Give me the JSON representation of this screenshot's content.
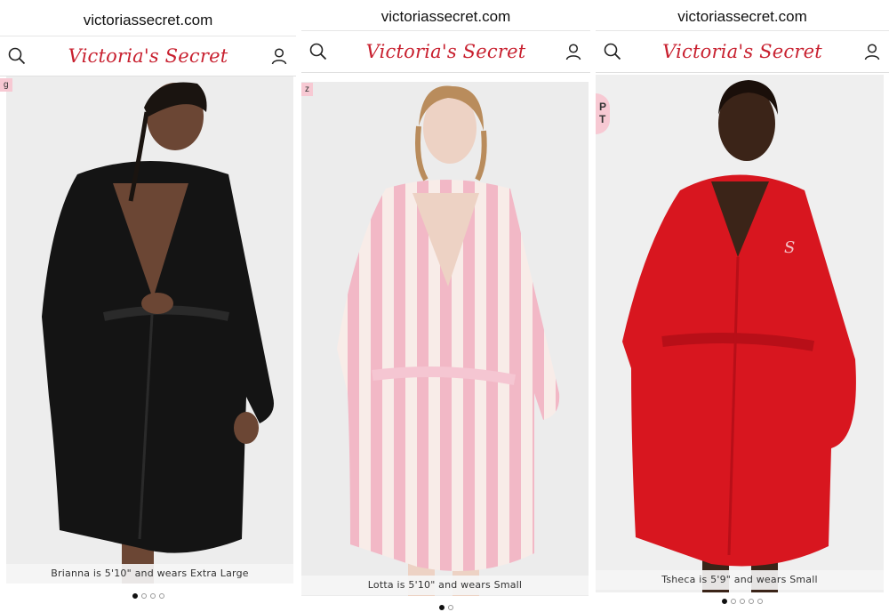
{
  "panels": [
    {
      "url": "victoriassecret.com",
      "logo": "Victoria's Secret",
      "badge": "g",
      "caption": "Brianna is 5'10\" and wears Extra Large",
      "dots": 4,
      "active_dot": 0,
      "robe_color": "#141414",
      "bg_color": "#ededed"
    },
    {
      "url": "victoriassecret.com",
      "logo": "Victoria's Secret",
      "badge": "z",
      "caption": "Lotta is 5'10\" and wears Small",
      "dots": 2,
      "active_dot": 0,
      "robe_color": "#f2b8c6",
      "bg_color": "#ececec"
    },
    {
      "url": "victoriassecret.com",
      "logo": "Victoria's Secret",
      "badge": "P T",
      "caption": "Tsheca is 5'9\" and wears Small",
      "dots": 5,
      "active_dot": 0,
      "robe_color": "#d8161f",
      "bg_color": "#efefef"
    }
  ],
  "icons": {
    "search": "search-icon",
    "account": "account-icon"
  },
  "colors": {
    "brand": "#c8202f"
  }
}
